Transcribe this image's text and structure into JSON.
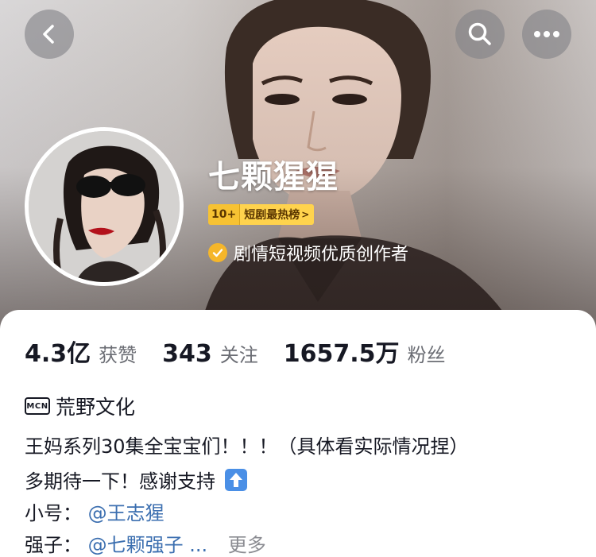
{
  "header": {
    "back_icon": "chevron-left-icon",
    "search_icon": "search-icon",
    "more_icon": "more-dots-icon"
  },
  "profile": {
    "name": "七颗猩猩",
    "rank_badge": {
      "number": "10+",
      "label": "短剧最热榜",
      "chevron": ">"
    },
    "verification": "剧情短视频优质创作者",
    "verify_color": "#f5b62a"
  },
  "stats": [
    {
      "value": "4.3亿",
      "label": "获赞"
    },
    {
      "value": "343",
      "label": "关注"
    },
    {
      "value": "1657.5万",
      "label": "粉丝"
    }
  ],
  "mcn": {
    "icon_text": "MCN",
    "name": "荒野文化"
  },
  "bio": {
    "line1": "王妈系列30集全宝宝们！！！（具体看实际情况捏）",
    "line2": "多期待一下！感谢支持",
    "line3_label": "小号：",
    "line3_mention": "@王志猩",
    "line4_label": "强子：",
    "line4_mention": "@七颗强子 ...",
    "more": "更多"
  },
  "colors": {
    "mention": "#3c6fb0",
    "badge": "#ffd34d"
  }
}
